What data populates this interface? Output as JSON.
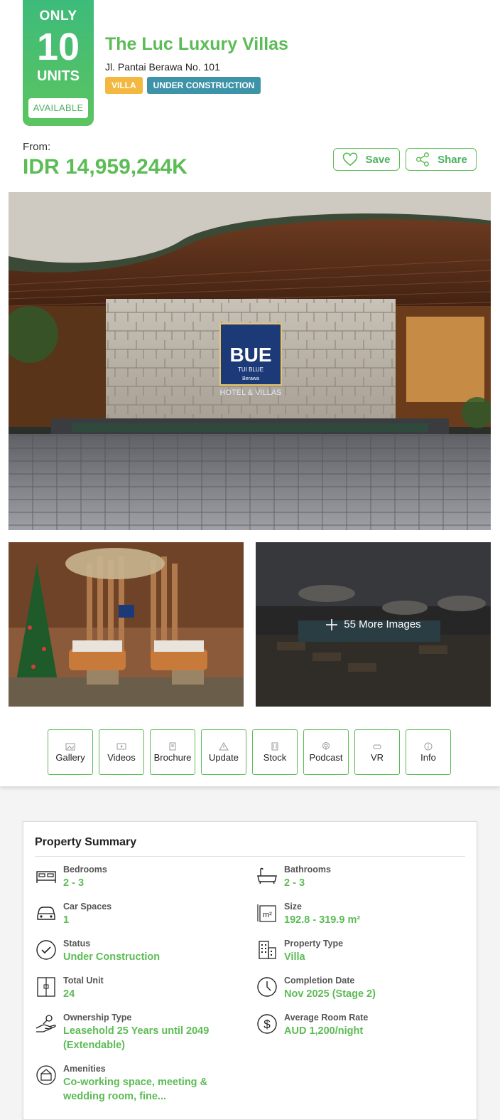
{
  "badge": {
    "only": "ONLY",
    "count": "10",
    "units": "UNITS",
    "available": "AVAILABLE"
  },
  "property": {
    "title": "The Luc Luxury Villas",
    "address": "Jl. Pantai Berawa No. 101",
    "tags": [
      "VILLA",
      "UNDER CONSTRUCTION"
    ]
  },
  "pricing": {
    "from_label": "From:",
    "price": "IDR 14,959,244K"
  },
  "actions": {
    "save": "Save",
    "share": "Share"
  },
  "hero_sign": {
    "top": "TUI BLUE",
    "sub": "Berawa",
    "line": "HOTEL & VILLAS"
  },
  "gallery": {
    "more_images": "55 More Images"
  },
  "media_tabs": [
    {
      "label": "Gallery",
      "icon": "gallery-icon"
    },
    {
      "label": "Videos",
      "icon": "video-icon"
    },
    {
      "label": "Brochure",
      "icon": "brochure-icon"
    },
    {
      "label": "Update",
      "icon": "update-icon"
    },
    {
      "label": "Stock",
      "icon": "stock-icon"
    },
    {
      "label": "Podcast",
      "icon": "podcast-icon"
    },
    {
      "label": "VR",
      "icon": "vr-icon"
    },
    {
      "label": "Info",
      "icon": "info-icon"
    }
  ],
  "summary": {
    "heading": "Property Summary",
    "items": [
      {
        "key": "Bedrooms",
        "value": "2 - 3",
        "icon": "bed-icon"
      },
      {
        "key": "Bathrooms",
        "value": "2 - 3",
        "icon": "bathtub-icon"
      },
      {
        "key": "Car Spaces",
        "value": "1",
        "icon": "car-icon"
      },
      {
        "key": "Size",
        "value": "192.8 - 319.9 m²",
        "icon": "area-icon"
      },
      {
        "key": "Status",
        "value": "Under Construction",
        "icon": "check-circle-icon"
      },
      {
        "key": "Property Type",
        "value": "Villa",
        "icon": "building-icon"
      },
      {
        "key": "Total Unit",
        "value": "24",
        "icon": "door-icon"
      },
      {
        "key": "Completion Date",
        "value": "Nov 2025 (Stage 2)",
        "icon": "clock-icon"
      },
      {
        "key": "Ownership Type",
        "value": "Leasehold 25 Years until 2049 (Extendable)",
        "icon": "hand-key-icon"
      },
      {
        "key": "Average Room Rate",
        "value": "AUD 1,200/night",
        "icon": "dollar-icon"
      },
      {
        "key": "Amenities",
        "value": "Co-working space, meeting & wedding room, fine...",
        "icon": "amenities-icon"
      }
    ]
  },
  "colors": {
    "brand_green": "#5cbc55",
    "villa_tag": "#f2b83f",
    "uc_tag": "#3d93a8"
  }
}
